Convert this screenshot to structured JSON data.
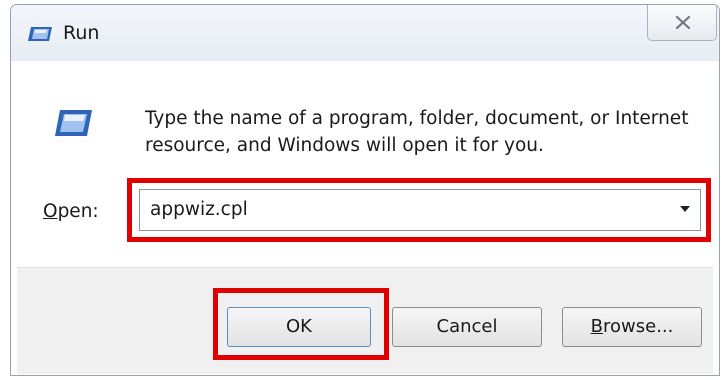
{
  "window": {
    "title": "Run",
    "title_icon": "run-icon",
    "close_icon": "close-icon"
  },
  "content": {
    "app_icon": "run-icon",
    "description": "Type the name of a program, folder, document, or Internet resource, and Windows will open it for you.",
    "open_label_mnemonic": "O",
    "open_label_rest": "pen:",
    "open_value": "appwiz.cpl"
  },
  "buttons": {
    "ok_label": "OK",
    "cancel_label": "Cancel",
    "browse_mnemonic": "B",
    "browse_rest": "rowse..."
  },
  "colors": {
    "highlight": "#e00000",
    "title_bar": "#e7edf4",
    "footer": "#f0f0f0"
  }
}
